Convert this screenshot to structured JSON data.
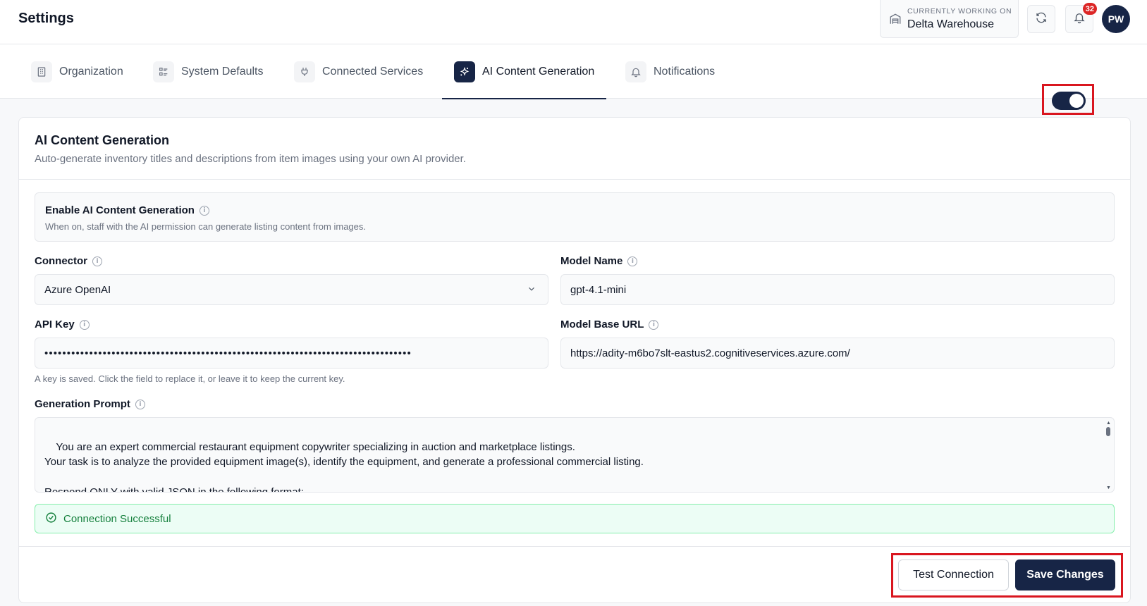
{
  "header": {
    "title": "Settings",
    "working_label": "CURRENTLY WORKING ON",
    "working_value": "Delta Warehouse",
    "notification_count": "32",
    "avatar_initials": "PW"
  },
  "tabs": [
    {
      "label": "Organization",
      "icon": "building-icon"
    },
    {
      "label": "System Defaults",
      "icon": "list-icon"
    },
    {
      "label": "Connected Services",
      "icon": "plug-icon"
    },
    {
      "label": "AI Content Generation",
      "icon": "sparkles-icon",
      "active": true
    },
    {
      "label": "Notifications",
      "icon": "bell-icon"
    }
  ],
  "card": {
    "title": "AI Content Generation",
    "subtitle": "Auto-generate inventory titles and descriptions from item images using your own AI provider."
  },
  "enable": {
    "title": "Enable AI Content Generation",
    "description": "When on, staff with the AI permission can generate listing content from images.",
    "enabled": true
  },
  "form": {
    "connector_label": "Connector",
    "connector_value": "Azure OpenAI",
    "model_name_label": "Model Name",
    "model_name_value": "gpt-4.1-mini",
    "api_key_label": "API Key",
    "api_key_value": "••••••••••••••••••••••••••••••••••••••••••••••••••••••••••••••••••••••••••••••••••",
    "api_key_hint": "A key is saved. Click the field to replace it, or leave it to keep the current key.",
    "base_url_label": "Model Base URL",
    "base_url_value": "https://adity-m6bo7slt-eastus2.cognitiveservices.azure.com/",
    "prompt_label": "Generation Prompt",
    "prompt_value": "You are an expert commercial restaurant equipment copywriter specializing in auction and marketplace listings.\nYour task is to analyze the provided equipment image(s), identify the equipment, and generate a professional commercial listing.\n\nRespond ONLY with valid JSON in the following format:\n{"
  },
  "status": {
    "message": "Connection Successful",
    "color": "#15803d"
  },
  "actions": {
    "test_label": "Test Connection",
    "save_label": "Save Changes"
  },
  "colors": {
    "primary": "#172546",
    "highlight": "#d9161f",
    "badge": "#dc2626"
  }
}
